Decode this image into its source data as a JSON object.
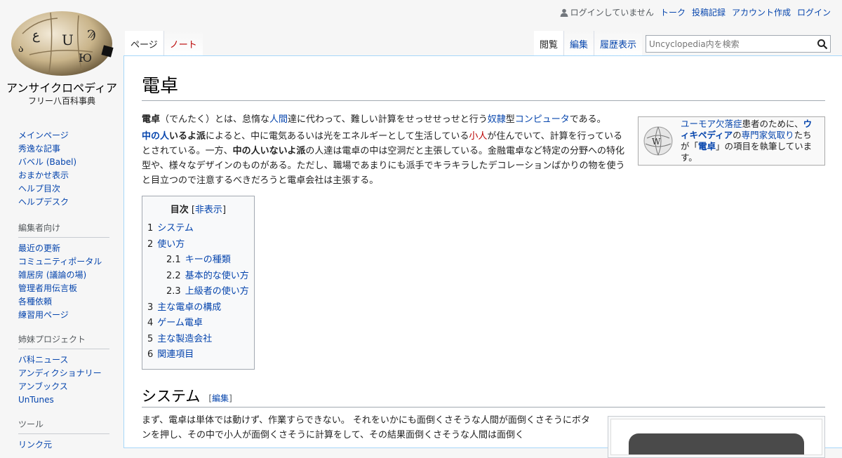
{
  "site": {
    "name": "アンサイクロペディア",
    "tagline": "フリー八百科事典"
  },
  "personal": {
    "not_logged_in": "ログインしていません",
    "talk": "トーク",
    "contributions": "投稿記録",
    "create_account": "アカウント作成",
    "login": "ログイン"
  },
  "tabs": {
    "page": "ページ",
    "note": "ノート",
    "read": "閲覧",
    "edit": "編集",
    "history": "履歴表示"
  },
  "search": {
    "placeholder": "Uncyclopedia内を検索"
  },
  "sidebar": {
    "nav": [
      "メインページ",
      "秀逸な記事",
      "バベル (Babel)",
      "おまかせ表示",
      "ヘルプ目次",
      "ヘルプデスク"
    ],
    "editors_heading": "編集者向け",
    "editors": [
      "最近の更新",
      "コミュニティポータル",
      "雑居房 (議論の場)",
      "管理者用伝言板",
      "各種依頼",
      "練習用ページ"
    ],
    "sister_heading": "姉妹プロジェクト",
    "sister": [
      "バ科ニュース",
      "アンディクショナリー",
      "アンブックス",
      "UnTunes"
    ],
    "tools_heading": "ツール",
    "tools": [
      "リンク元"
    ]
  },
  "article": {
    "title": "電卓",
    "humor_box": {
      "link1": "ユーモア欠落症",
      "t1": "患者のために、",
      "link2": "ウィキペディア",
      "t2": "の",
      "link3": "専門家気取り",
      "t3": "たちが「",
      "link4": "電卓",
      "t4": "」の項目を執筆しています。"
    },
    "p1": {
      "b1": "電卓",
      "t1": "（でんたく）とは、怠惰な",
      "l1": "人間",
      "t2": "達に代わって、難しい計算をせっせせっせと行う",
      "l2": "奴隷",
      "t3": "型",
      "l3": "コンピュータ",
      "t4": "である。"
    },
    "p2": {
      "l1": "中の人",
      "b1": "いるよ派",
      "t1": "によると、中に電気あるいは光をエネルギーとして生活している",
      "l2": "小人",
      "t2": "が住んでいて、計算を行っているとされている。一方、",
      "b2": "中の人いないよ派",
      "t3": "の人達は電卓の中は空洞だと主張している。金融電卓など特定の分野への特化型や、様々なデザインのものがある。ただし、職場であまりにも派手でキラキラしたデコレーションばかりの物を使うと目立つので注意するべきだろうと電卓会社は主張する。"
    },
    "toc": {
      "title": "目次",
      "hide_open": "[",
      "hide": "非表示",
      "hide_close": "]",
      "items": [
        {
          "num": "1",
          "text": "システム",
          "level": 1
        },
        {
          "num": "2",
          "text": "使い方",
          "level": 1
        },
        {
          "num": "2.1",
          "text": "キーの種類",
          "level": 2
        },
        {
          "num": "2.2",
          "text": "基本的な使い方",
          "level": 2
        },
        {
          "num": "2.3",
          "text": "上級者の使い方",
          "level": 2
        },
        {
          "num": "3",
          "text": "主な電卓の構成",
          "level": 1
        },
        {
          "num": "4",
          "text": "ゲーム電卓",
          "level": 1
        },
        {
          "num": "5",
          "text": "主な製造会社",
          "level": 1
        },
        {
          "num": "6",
          "text": "関連項目",
          "level": 1
        }
      ]
    },
    "section1": {
      "title": "システム",
      "edit_open": "[",
      "edit": "編集",
      "edit_close": "]",
      "text": "まず、電卓は単体では動けず、作業すらできない。 それをいかにも面倒くさそうな人間が面倒くさそうにボタンを押し、その中で小人が面倒くさそうに計算をして、その結果面倒くさそうな人間は面倒く"
    }
  },
  "colors": {
    "link": "#0645ad",
    "redlink": "#ba0000",
    "border": "#a7d7f9"
  }
}
